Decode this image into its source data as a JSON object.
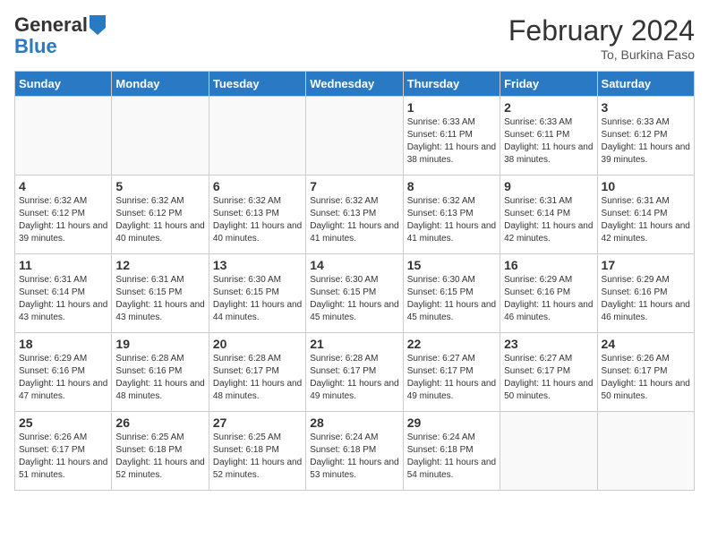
{
  "header": {
    "logo_line1": "General",
    "logo_line2": "Blue",
    "month_title": "February 2024",
    "subtitle": "To, Burkina Faso"
  },
  "days_of_week": [
    "Sunday",
    "Monday",
    "Tuesday",
    "Wednesday",
    "Thursday",
    "Friday",
    "Saturday"
  ],
  "weeks": [
    [
      {
        "day": "",
        "sunrise": "",
        "sunset": "",
        "daylight": "",
        "empty": true
      },
      {
        "day": "",
        "sunrise": "",
        "sunset": "",
        "daylight": "",
        "empty": true
      },
      {
        "day": "",
        "sunrise": "",
        "sunset": "",
        "daylight": "",
        "empty": true
      },
      {
        "day": "",
        "sunrise": "",
        "sunset": "",
        "daylight": "",
        "empty": true
      },
      {
        "day": "1",
        "sunrise": "Sunrise: 6:33 AM",
        "sunset": "Sunset: 6:11 PM",
        "daylight": "Daylight: 11 hours and 38 minutes.",
        "empty": false
      },
      {
        "day": "2",
        "sunrise": "Sunrise: 6:33 AM",
        "sunset": "Sunset: 6:11 PM",
        "daylight": "Daylight: 11 hours and 38 minutes.",
        "empty": false
      },
      {
        "day": "3",
        "sunrise": "Sunrise: 6:33 AM",
        "sunset": "Sunset: 6:12 PM",
        "daylight": "Daylight: 11 hours and 39 minutes.",
        "empty": false
      }
    ],
    [
      {
        "day": "4",
        "sunrise": "Sunrise: 6:32 AM",
        "sunset": "Sunset: 6:12 PM",
        "daylight": "Daylight: 11 hours and 39 minutes.",
        "empty": false
      },
      {
        "day": "5",
        "sunrise": "Sunrise: 6:32 AM",
        "sunset": "Sunset: 6:12 PM",
        "daylight": "Daylight: 11 hours and 40 minutes.",
        "empty": false
      },
      {
        "day": "6",
        "sunrise": "Sunrise: 6:32 AM",
        "sunset": "Sunset: 6:13 PM",
        "daylight": "Daylight: 11 hours and 40 minutes.",
        "empty": false
      },
      {
        "day": "7",
        "sunrise": "Sunrise: 6:32 AM",
        "sunset": "Sunset: 6:13 PM",
        "daylight": "Daylight: 11 hours and 41 minutes.",
        "empty": false
      },
      {
        "day": "8",
        "sunrise": "Sunrise: 6:32 AM",
        "sunset": "Sunset: 6:13 PM",
        "daylight": "Daylight: 11 hours and 41 minutes.",
        "empty": false
      },
      {
        "day": "9",
        "sunrise": "Sunrise: 6:31 AM",
        "sunset": "Sunset: 6:14 PM",
        "daylight": "Daylight: 11 hours and 42 minutes.",
        "empty": false
      },
      {
        "day": "10",
        "sunrise": "Sunrise: 6:31 AM",
        "sunset": "Sunset: 6:14 PM",
        "daylight": "Daylight: 11 hours and 42 minutes.",
        "empty": false
      }
    ],
    [
      {
        "day": "11",
        "sunrise": "Sunrise: 6:31 AM",
        "sunset": "Sunset: 6:14 PM",
        "daylight": "Daylight: 11 hours and 43 minutes.",
        "empty": false
      },
      {
        "day": "12",
        "sunrise": "Sunrise: 6:31 AM",
        "sunset": "Sunset: 6:15 PM",
        "daylight": "Daylight: 11 hours and 43 minutes.",
        "empty": false
      },
      {
        "day": "13",
        "sunrise": "Sunrise: 6:30 AM",
        "sunset": "Sunset: 6:15 PM",
        "daylight": "Daylight: 11 hours and 44 minutes.",
        "empty": false
      },
      {
        "day": "14",
        "sunrise": "Sunrise: 6:30 AM",
        "sunset": "Sunset: 6:15 PM",
        "daylight": "Daylight: 11 hours and 45 minutes.",
        "empty": false
      },
      {
        "day": "15",
        "sunrise": "Sunrise: 6:30 AM",
        "sunset": "Sunset: 6:15 PM",
        "daylight": "Daylight: 11 hours and 45 minutes.",
        "empty": false
      },
      {
        "day": "16",
        "sunrise": "Sunrise: 6:29 AM",
        "sunset": "Sunset: 6:16 PM",
        "daylight": "Daylight: 11 hours and 46 minutes.",
        "empty": false
      },
      {
        "day": "17",
        "sunrise": "Sunrise: 6:29 AM",
        "sunset": "Sunset: 6:16 PM",
        "daylight": "Daylight: 11 hours and 46 minutes.",
        "empty": false
      }
    ],
    [
      {
        "day": "18",
        "sunrise": "Sunrise: 6:29 AM",
        "sunset": "Sunset: 6:16 PM",
        "daylight": "Daylight: 11 hours and 47 minutes.",
        "empty": false
      },
      {
        "day": "19",
        "sunrise": "Sunrise: 6:28 AM",
        "sunset": "Sunset: 6:16 PM",
        "daylight": "Daylight: 11 hours and 48 minutes.",
        "empty": false
      },
      {
        "day": "20",
        "sunrise": "Sunrise: 6:28 AM",
        "sunset": "Sunset: 6:17 PM",
        "daylight": "Daylight: 11 hours and 48 minutes.",
        "empty": false
      },
      {
        "day": "21",
        "sunrise": "Sunrise: 6:28 AM",
        "sunset": "Sunset: 6:17 PM",
        "daylight": "Daylight: 11 hours and 49 minutes.",
        "empty": false
      },
      {
        "day": "22",
        "sunrise": "Sunrise: 6:27 AM",
        "sunset": "Sunset: 6:17 PM",
        "daylight": "Daylight: 11 hours and 49 minutes.",
        "empty": false
      },
      {
        "day": "23",
        "sunrise": "Sunrise: 6:27 AM",
        "sunset": "Sunset: 6:17 PM",
        "daylight": "Daylight: 11 hours and 50 minutes.",
        "empty": false
      },
      {
        "day": "24",
        "sunrise": "Sunrise: 6:26 AM",
        "sunset": "Sunset: 6:17 PM",
        "daylight": "Daylight: 11 hours and 50 minutes.",
        "empty": false
      }
    ],
    [
      {
        "day": "25",
        "sunrise": "Sunrise: 6:26 AM",
        "sunset": "Sunset: 6:17 PM",
        "daylight": "Daylight: 11 hours and 51 minutes.",
        "empty": false
      },
      {
        "day": "26",
        "sunrise": "Sunrise: 6:25 AM",
        "sunset": "Sunset: 6:18 PM",
        "daylight": "Daylight: 11 hours and 52 minutes.",
        "empty": false
      },
      {
        "day": "27",
        "sunrise": "Sunrise: 6:25 AM",
        "sunset": "Sunset: 6:18 PM",
        "daylight": "Daylight: 11 hours and 52 minutes.",
        "empty": false
      },
      {
        "day": "28",
        "sunrise": "Sunrise: 6:24 AM",
        "sunset": "Sunset: 6:18 PM",
        "daylight": "Daylight: 11 hours and 53 minutes.",
        "empty": false
      },
      {
        "day": "29",
        "sunrise": "Sunrise: 6:24 AM",
        "sunset": "Sunset: 6:18 PM",
        "daylight": "Daylight: 11 hours and 54 minutes.",
        "empty": false
      },
      {
        "day": "",
        "sunrise": "",
        "sunset": "",
        "daylight": "",
        "empty": true
      },
      {
        "day": "",
        "sunrise": "",
        "sunset": "",
        "daylight": "",
        "empty": true
      }
    ]
  ]
}
